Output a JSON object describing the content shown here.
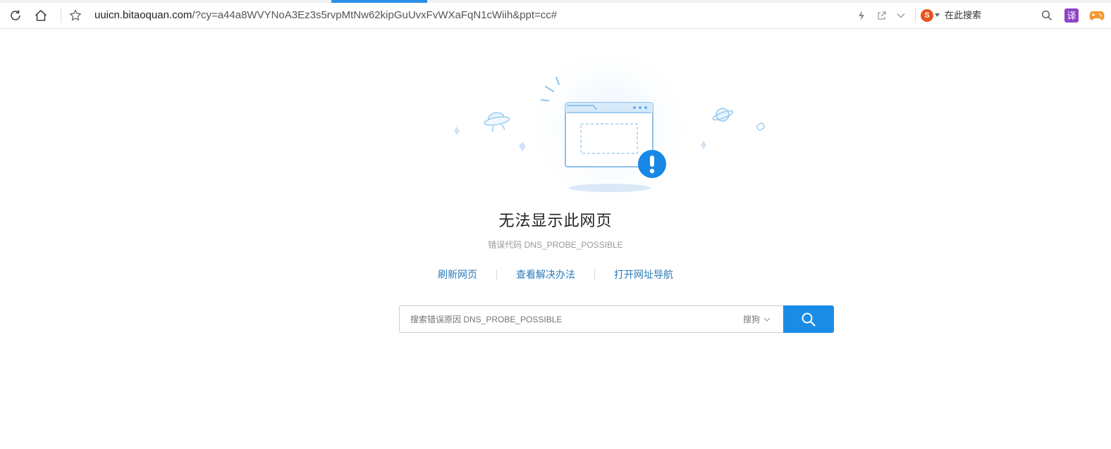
{
  "address_bar": {
    "url_host": "uuicn.bitaoquan.com",
    "url_path": "/?cy=a44a8WVYNoA3Ez3s5rvpMtNw62kipGuUvxFvWXaFqN1cWiih&ppt=cc#"
  },
  "search_box": {
    "placeholder": "在此搜索",
    "engine_icon": "sogou-icon"
  },
  "toolbar_icons": [
    "refresh-icon",
    "home-icon",
    "star-icon",
    "lightning-icon",
    "share-icon",
    "chevron-down-icon",
    "search-icon",
    "translate-icon",
    "gamepad-icon"
  ],
  "translate_label": "译",
  "error": {
    "title": "无法显示此网页",
    "code_text": "错误代码 DNS_PROBE_POSSIBLE",
    "links": [
      "刷新网页",
      "查看解决办法",
      "打开网址导航"
    ]
  },
  "error_search": {
    "placeholder": "搜索错误原因 DNS_PROBE_POSSIBLE",
    "engine": "搜狗"
  },
  "colors": {
    "accent": "#1a8ce6",
    "link": "#2a7ab8",
    "alert": "#1788e6",
    "tab_indicator": "#2b8fe8"
  }
}
